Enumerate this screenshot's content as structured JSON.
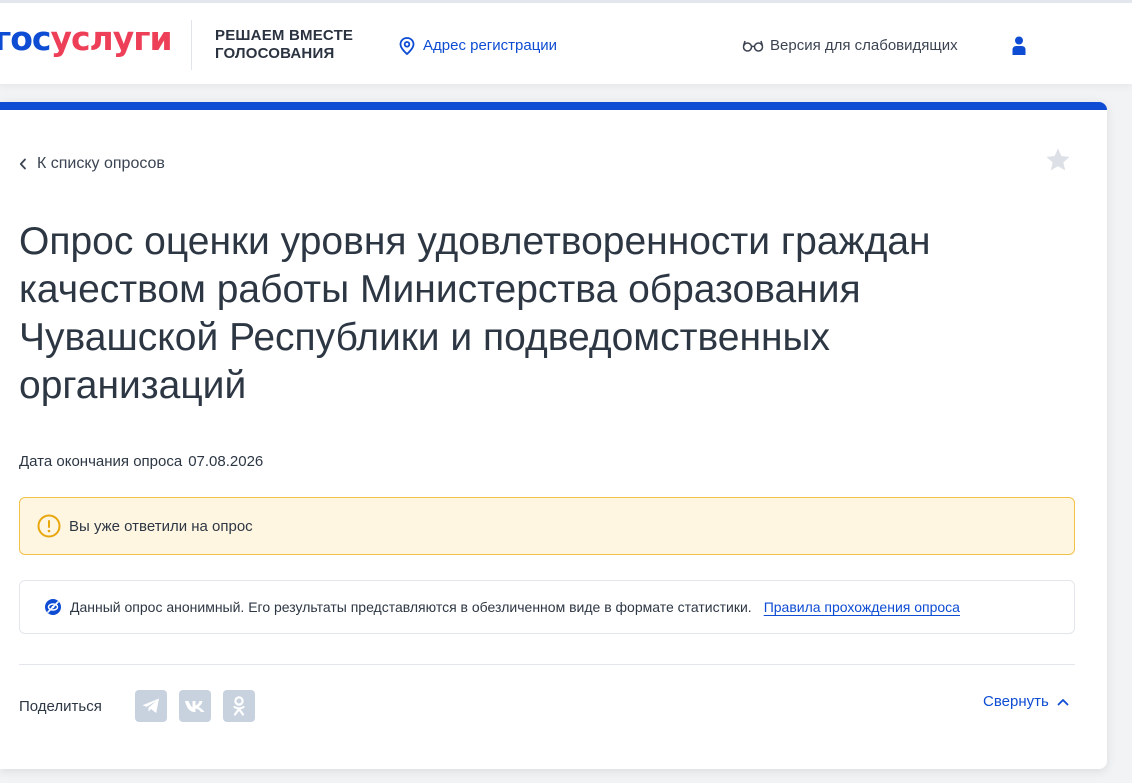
{
  "header": {
    "logo_part1": "гос",
    "logo_part2": "услуги",
    "project_line1": "РЕШАЕМ ВМЕСТЕ",
    "project_line2": "ГОЛОСОВАНИЯ",
    "address_label": "Адрес регистрации",
    "accessibility_label": "Версия для слабовидящих"
  },
  "survey": {
    "back_label": "К списку опросов",
    "title": "Опрос оценки уровня удовлетворенности граждан качеством работы Министерства образования Чувашской Республики и подведомственных организаций",
    "end_date_label": "Дата окончания опроса",
    "end_date_value": "07.08.2026",
    "alert_text": "Вы уже ответили на опрос",
    "info_text": "Данный опрос анонимный. Его результаты представляются в обезличенном виде в формате статистики.",
    "info_link": "Правила прохождения опроса",
    "share_label": "Поделиться",
    "collapse_label": "Свернуть"
  },
  "colors": {
    "brand_blue": "#0d4cd3",
    "brand_red": "#ee3f58",
    "alert_bg": "#fff6e2",
    "alert_border": "#f2c14a",
    "share_bg": "#c8d2de"
  },
  "icons": {
    "address": "location-pin-icon",
    "accessibility": "glasses-icon",
    "user": "user-icon",
    "back": "chevron-left-icon",
    "favorite": "star-icon",
    "alert": "exclamation-circle-icon",
    "anonymous": "eye-off-icon",
    "share": [
      "telegram-icon",
      "vk-icon",
      "odnoklassniki-icon"
    ],
    "collapse": "chevron-up-icon"
  }
}
